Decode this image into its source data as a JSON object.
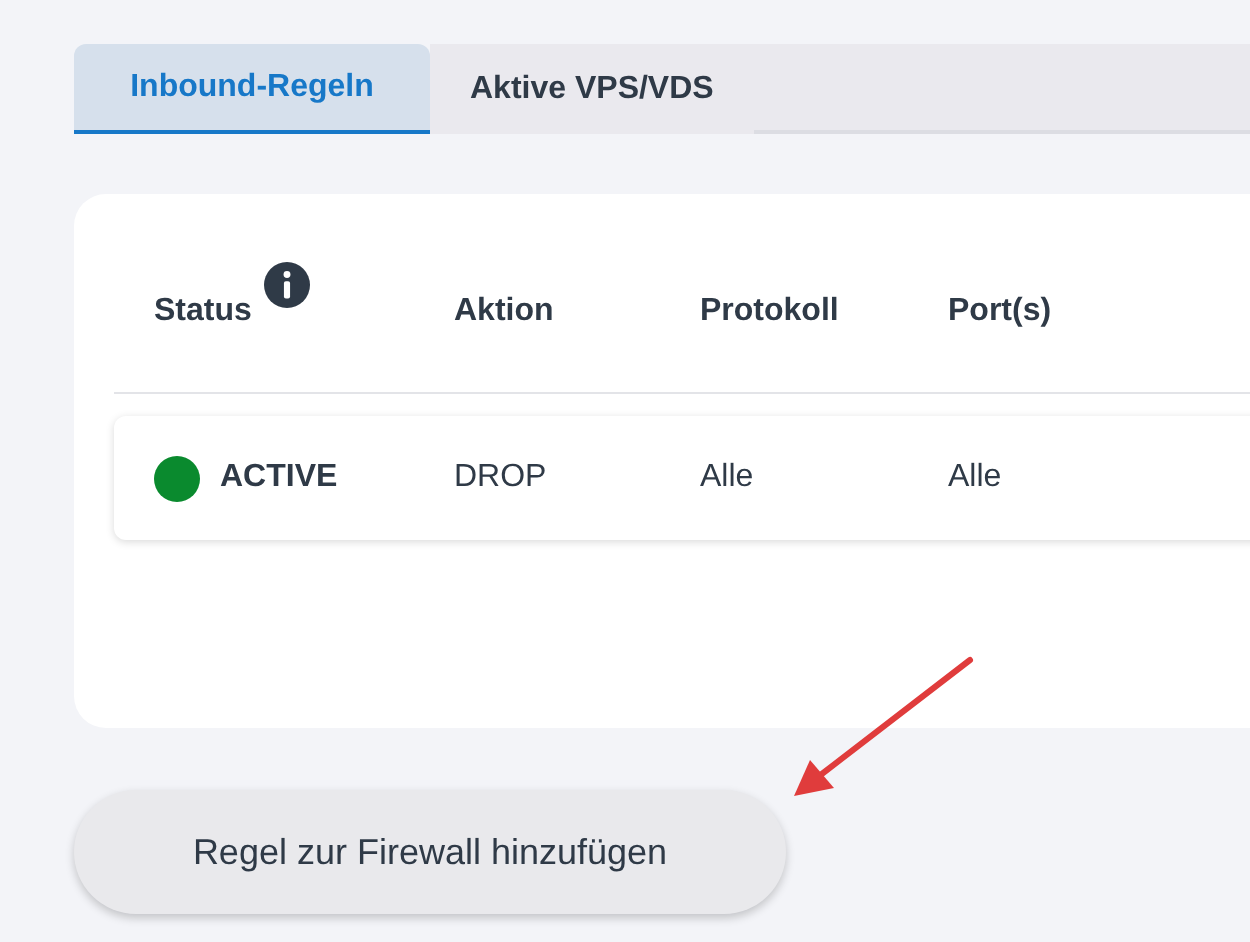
{
  "tabs": [
    {
      "label": "Inbound-Regeln",
      "selected": true
    },
    {
      "label": "Aktive VPS/VDS",
      "selected": false
    }
  ],
  "table": {
    "columns": [
      {
        "label": "Status",
        "info": true
      },
      {
        "label": "Aktion",
        "info": false
      },
      {
        "label": "Protokoll",
        "info": false
      },
      {
        "label": "Port(s)",
        "info": false
      }
    ],
    "rows": [
      {
        "status": "ACTIVE",
        "color": "#0a8a2e",
        "action": "DROP",
        "protocol": "Alle",
        "ports": "Alle"
      }
    ]
  },
  "add_button": "Regel zur Firewall hinzufügen"
}
